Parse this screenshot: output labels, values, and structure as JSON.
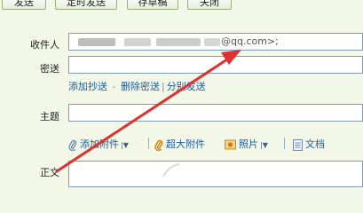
{
  "toolbar": {
    "send_label": "发送",
    "timed_send_label": "定时发送",
    "draft_label": "存草稿",
    "close_label": "关闭"
  },
  "compose": {
    "to_label": "收件人",
    "to_value_suffix": "@qq.com>;",
    "cc_label": "密送",
    "subject_label": "主题",
    "body_label": "正文"
  },
  "recipient_links": {
    "add_cc": "添加抄送",
    "separator1": " - ",
    "remove_bcc": "删除密送",
    "separator2": "|",
    "separate_send": "分别发送"
  },
  "attachments": {
    "add_attachment": "添加附件",
    "large_attachment": "超大附件",
    "photo": "照片",
    "document": "文档"
  },
  "colors": {
    "arrow": "#e03030",
    "background": "#f3f7e8",
    "link": "#1d5b9e"
  }
}
